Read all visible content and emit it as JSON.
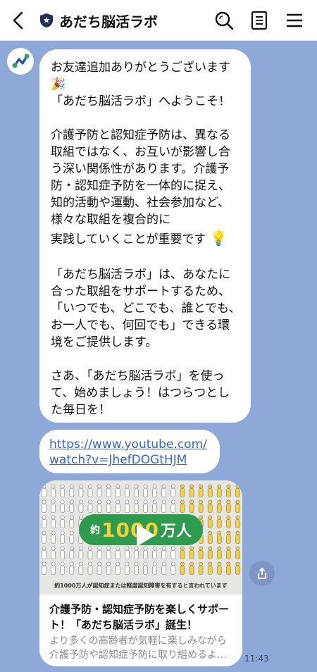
{
  "header": {
    "title": "あだち脳活ラボ",
    "back_icon": "chevron-left-icon",
    "badge_icon": "shield-icon",
    "search_icon": "search-icon",
    "notes_icon": "notes-icon",
    "menu_icon": "menu-icon"
  },
  "messages": {
    "welcome": {
      "line1": "お友達追加ありがとうございます",
      "line2_emoji": "🎉",
      "line3": "「あだち脳活ラボ」へようこそ！",
      "para2": "介護予防と認知症予防は、異なる取組ではなく、お互いが影響し合う深い関係性があります。介護予防・認知症予防を一体的に捉え、知的活動や運動、社会参加など、様々な取組を複合的に",
      "para2_last": "実践していくことが重要です",
      "para2_emoji": "💡",
      "para3": "「あだち脳活ラボ」は、あなたに合った取組をサポートするため、「いつでも、どこでも、誰とでも、お一人でも、何回でも」できる環境をご提供します。",
      "para4": "さあ、「あだち脳活ラボ」を使って、始めましょう！はつらつとした毎日を！"
    },
    "link": {
      "url": "https://www.youtube.com/watch?v=JhefDOGtHJM"
    },
    "card": {
      "thumbnail_big_text_prefix": "約",
      "thumbnail_big_number": "1000",
      "thumbnail_big_suffix": "万人",
      "thumbnail_caption": "約1000万人が認知症または軽度認知障害を有すると言われています",
      "title": "介護予防・認知症予防を楽しくサポート！「あだち脳活ラボ」誕生！",
      "description": "より多くの高齢者が気軽に楽しみながら介護予防や認知症予防に取り組めるよう、あだち脳活ラボが誕生しました。"
    },
    "timestamp": "11:43"
  },
  "colors": {
    "background": "#8EA8D8",
    "bubble": "#FFFFFF",
    "link": "#3A64C8",
    "thumb_green": "#2E9B4E",
    "thumb_yellow": "#F2D23C"
  }
}
